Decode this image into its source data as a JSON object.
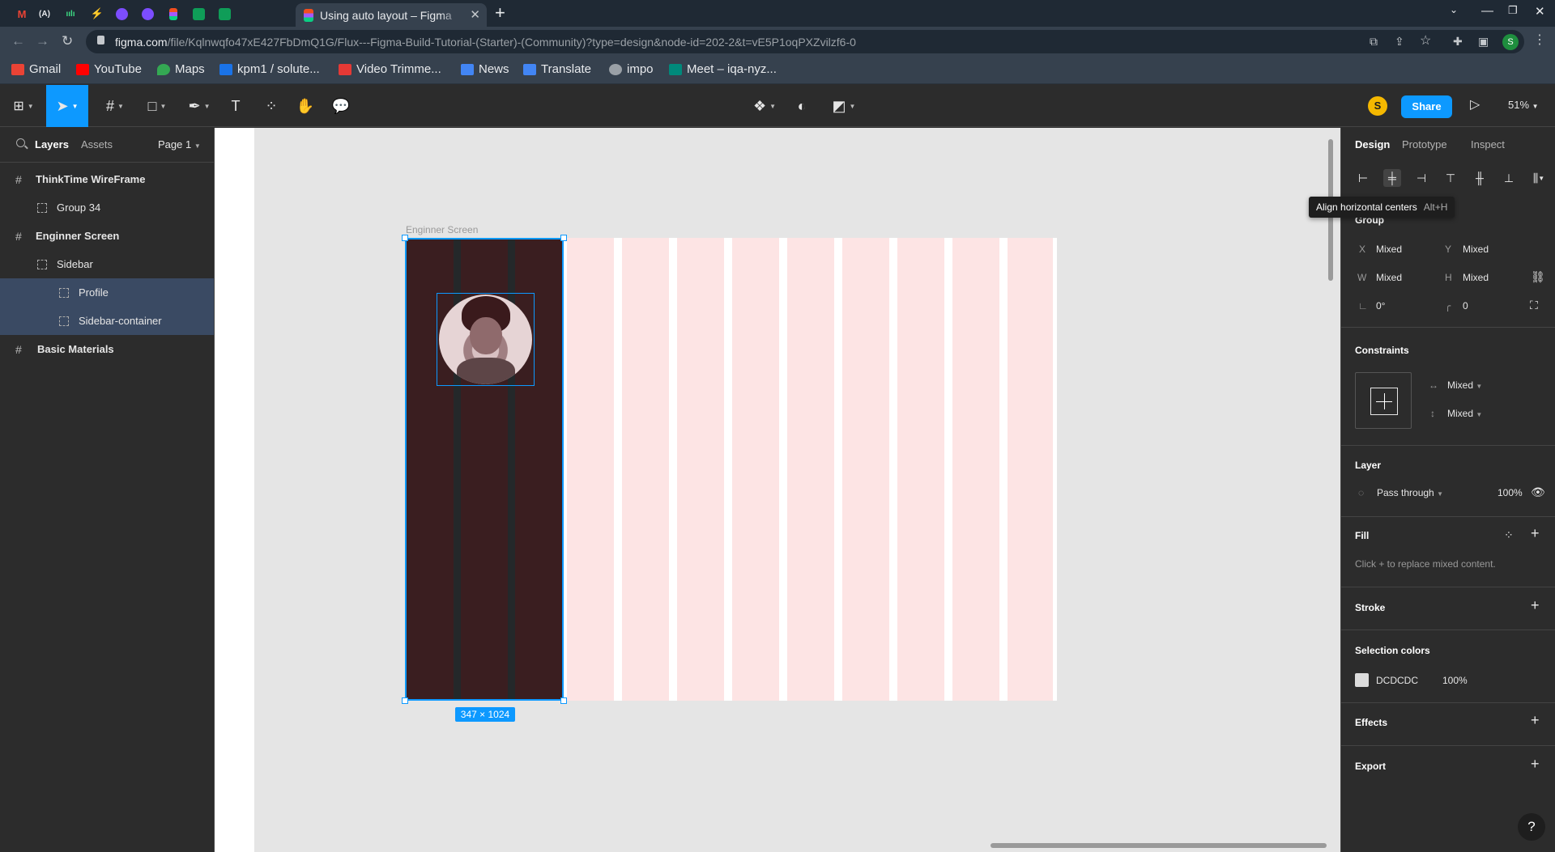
{
  "browser": {
    "active_tab_title": "Using auto layout – Figma",
    "tab_close": "✕",
    "new_tab": "+",
    "url_domain": "figma.com",
    "url_path": "/file/Kqlnwqfo47xE427FbDmQ1G/Flux---Figma-Build-Tutorial-(Starter)-(Community)?type=design&node-id=202-2&t=vE5P1oqPXZvilzf6-0",
    "profile_initial": "S",
    "bookmarks": [
      {
        "label": "Gmail",
        "color": "#ea4335"
      },
      {
        "label": "YouTube",
        "color": "#ff0000"
      },
      {
        "label": "Maps",
        "color": "#34a853"
      },
      {
        "label": "kpm1 / solute...",
        "color": "#1a73e8"
      },
      {
        "label": "Video Trimme...",
        "color": "#e53935"
      },
      {
        "label": "News",
        "color": "#4285f4"
      },
      {
        "label": "Translate",
        "color": "#4285f4"
      },
      {
        "label": "impo",
        "color": "#9aa0a6"
      },
      {
        "label": "Meet – iqa-nyz...",
        "color": "#00897b"
      }
    ]
  },
  "toolbar": {
    "avatar_initial": "S",
    "share_label": "Share",
    "zoom_label": "51%",
    "text_tool": "T"
  },
  "left_panel": {
    "tabs": {
      "layers": "Layers",
      "assets": "Assets",
      "page": "Page 1"
    },
    "layers": [
      {
        "label": "ThinkTime WireFrame",
        "type": "frame",
        "selected": false
      },
      {
        "label": "Group 34",
        "type": "group",
        "selected": false
      },
      {
        "label": "Enginner Screen",
        "type": "frame",
        "selected": false
      },
      {
        "label": "Sidebar",
        "type": "group",
        "selected": false
      },
      {
        "label": "Profile",
        "type": "group",
        "selected": true
      },
      {
        "label": "Sidebar-container",
        "type": "group",
        "selected": true
      },
      {
        "label": "Basic Materials",
        "type": "frame",
        "selected": false
      }
    ]
  },
  "canvas": {
    "frame_label": "Enginner Screen",
    "size_badge": "347 × 1024"
  },
  "right_panel": {
    "tabs": {
      "design": "Design",
      "prototype": "Prototype",
      "inspect": "Inspect"
    },
    "tooltip": {
      "text": "Align horizontal centers",
      "shortcut": "Alt+H"
    },
    "group_title": "Group",
    "x_label": "X",
    "x_value": "Mixed",
    "y_label": "Y",
    "y_value": "Mixed",
    "w_label": "W",
    "w_value": "Mixed",
    "h_label": "H",
    "h_value": "Mixed",
    "rotation": "0°",
    "radius": "0",
    "constraints_title": "Constraints",
    "constraint_h": "Mixed",
    "constraint_v": "Mixed",
    "layer_title": "Layer",
    "blend_mode": "Pass through",
    "opacity": "100%",
    "fill_title": "Fill",
    "fill_hint": "Click + to replace mixed content.",
    "stroke_title": "Stroke",
    "selection_colors_title": "Selection colors",
    "selection_color_hex": "DCDCDC",
    "selection_color_opacity": "100%",
    "effects_title": "Effects",
    "export_title": "Export",
    "help_label": "?"
  }
}
